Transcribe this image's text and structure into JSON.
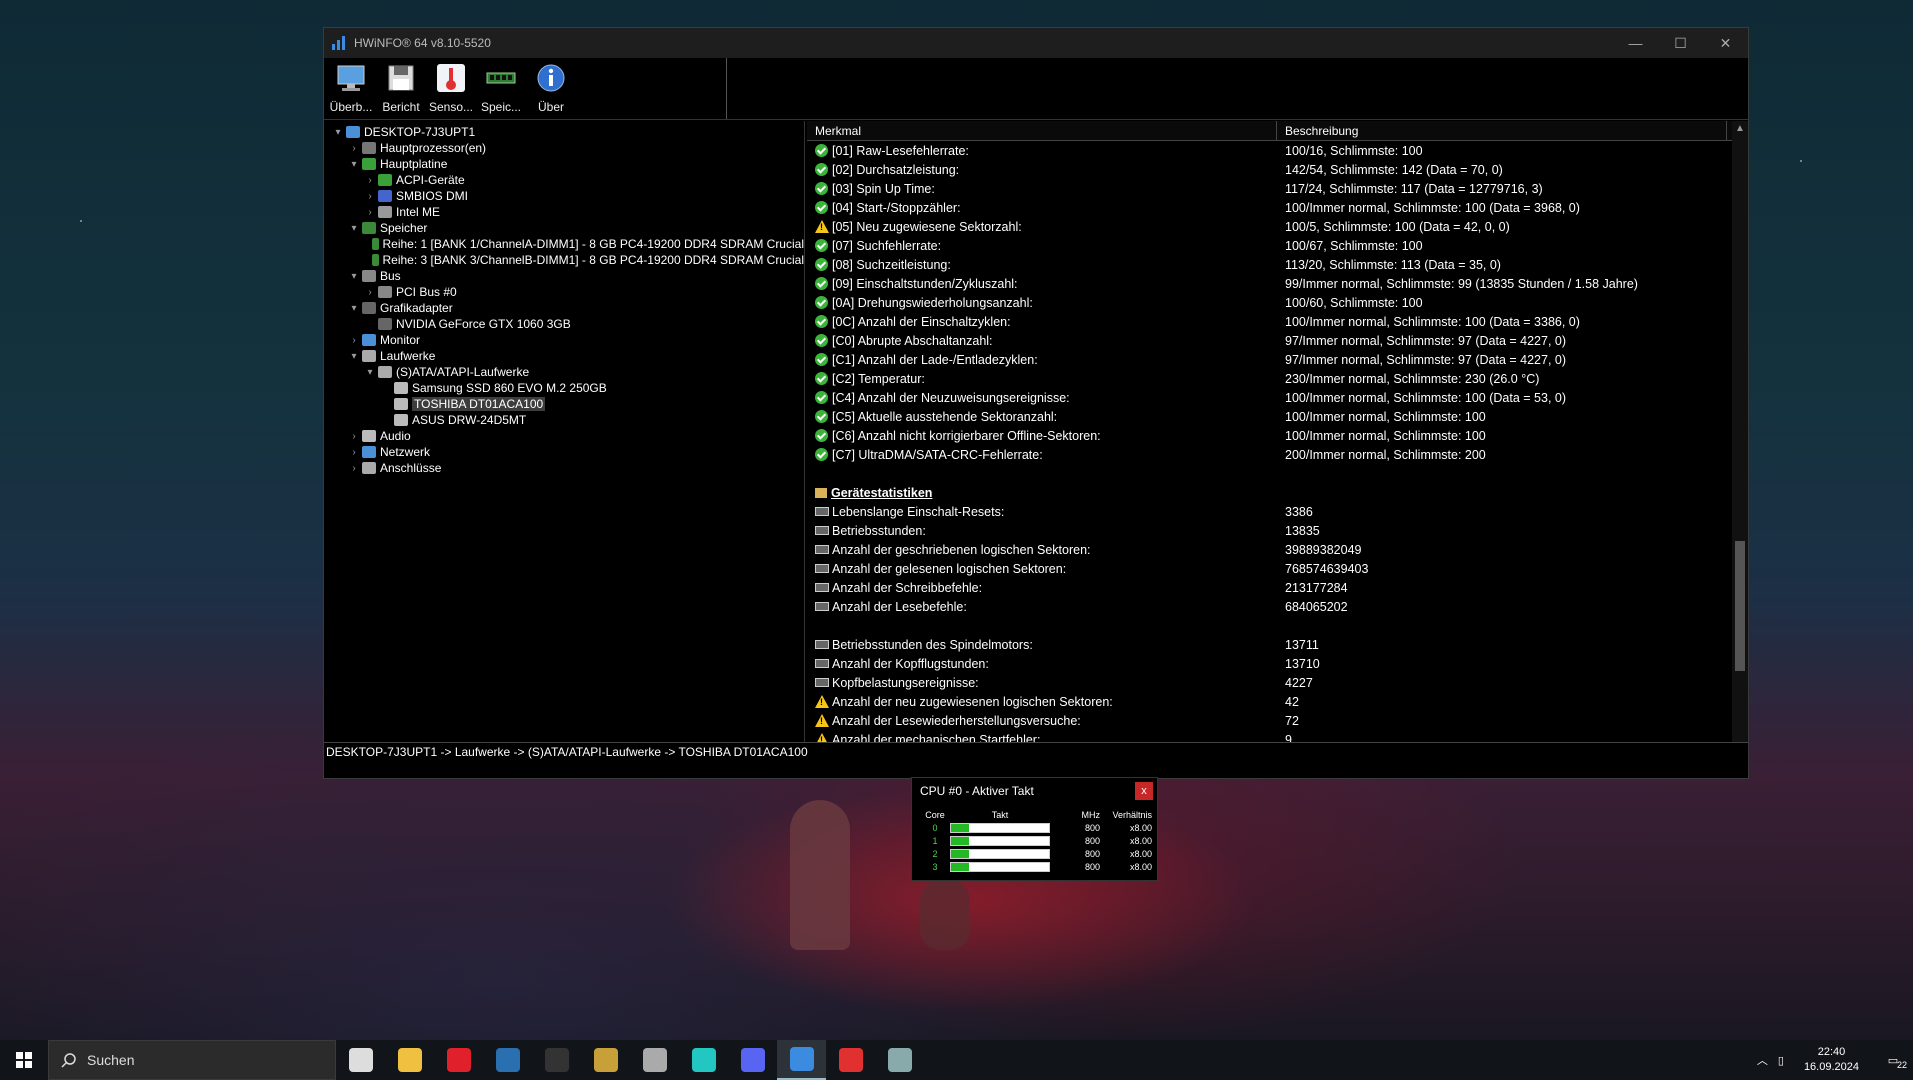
{
  "window": {
    "title": "HWiNFO® 64 v8.10-5520",
    "controls": {
      "minimize": "—",
      "maximize": "☐",
      "close": "✕"
    }
  },
  "toolbar": {
    "items": [
      {
        "label": "Überb...",
        "icon": "monitor-icon"
      },
      {
        "label": "Bericht",
        "icon": "save-icon"
      },
      {
        "label": "Senso...",
        "icon": "thermometer-icon"
      },
      {
        "label": "Speic...",
        "icon": "memory-icon"
      },
      {
        "label": "Über",
        "icon": "info-icon"
      }
    ]
  },
  "tree": {
    "rows": [
      {
        "label": "DESKTOP-7J3UPT1",
        "level": 0,
        "arrow": "▾",
        "color": "#4a90d9"
      },
      {
        "label": "Hauptprozessor(en)",
        "level": 1,
        "arrow": "›",
        "color": "#777"
      },
      {
        "label": "Hauptplatine",
        "level": 1,
        "arrow": "▾",
        "color": "#3aa03a"
      },
      {
        "label": "ACPI-Geräte",
        "level": 2,
        "arrow": "›",
        "color": "#3aa03a"
      },
      {
        "label": "SMBIOS DMI",
        "level": 2,
        "arrow": "›",
        "color": "#4466cc"
      },
      {
        "label": "Intel ME",
        "level": 2,
        "arrow": "›",
        "color": "#999"
      },
      {
        "label": "Speicher",
        "level": 1,
        "arrow": "▾",
        "color": "#3a8a3a"
      },
      {
        "label": "Reihe: 1 [BANK 1/ChannelA-DIMM1] - 8 GB PC4-19200 DDR4 SDRAM Crucial",
        "level": 2,
        "arrow": "",
        "color": "#3a8a3a"
      },
      {
        "label": "Reihe: 3 [BANK 3/ChannelB-DIMM1] - 8 GB PC4-19200 DDR4 SDRAM Crucial",
        "level": 2,
        "arrow": "",
        "color": "#3a8a3a"
      },
      {
        "label": "Bus",
        "level": 1,
        "arrow": "▾",
        "color": "#888"
      },
      {
        "label": "PCI Bus #0",
        "level": 2,
        "arrow": "›",
        "color": "#888"
      },
      {
        "label": "Grafikadapter",
        "level": 1,
        "arrow": "▾",
        "color": "#666"
      },
      {
        "label": "NVIDIA GeForce GTX 1060 3GB",
        "level": 2,
        "arrow": "",
        "color": "#666"
      },
      {
        "label": "Monitor",
        "level": 1,
        "arrow": "›",
        "color": "#4a90d9"
      },
      {
        "label": "Laufwerke",
        "level": 1,
        "arrow": "▾",
        "color": "#aaa"
      },
      {
        "label": "(S)ATA/ATAPI-Laufwerke",
        "level": 2,
        "arrow": "▾",
        "color": "#aaa"
      },
      {
        "label": "Samsung SSD 860 EVO M.2 250GB",
        "level": 3,
        "arrow": "",
        "color": "#bbb"
      },
      {
        "label": "TOSHIBA DT01ACA100",
        "level": 3,
        "arrow": "",
        "color": "#bbb",
        "selected": true
      },
      {
        "label": "ASUS DRW-24D5MT",
        "level": 3,
        "arrow": "",
        "color": "#bbb"
      },
      {
        "label": "Audio",
        "level": 1,
        "arrow": "›",
        "color": "#bbb"
      },
      {
        "label": "Netzwerk",
        "level": 1,
        "arrow": "›",
        "color": "#4a90d9"
      },
      {
        "label": "Anschlüsse",
        "level": 1,
        "arrow": "›",
        "color": "#aaa"
      }
    ]
  },
  "details": {
    "headers": {
      "merkmal": "Merkmal",
      "beschreibung": "Beschreibung"
    },
    "rows": [
      {
        "icon": "ok",
        "name": "[01] Raw-Lesefehlerrate:",
        "value": "100/16, Schlimmste: 100"
      },
      {
        "icon": "ok",
        "name": "[02] Durchsatzleistung:",
        "value": "142/54, Schlimmste: 142 (Data = 70, 0)"
      },
      {
        "icon": "ok",
        "name": "[03] Spin Up Time:",
        "value": "117/24, Schlimmste: 117 (Data = 12779716, 3)"
      },
      {
        "icon": "ok",
        "name": "[04] Start-/Stoppzähler:",
        "value": "100/Immer normal, Schlimmste: 100 (Data = 3968, 0)"
      },
      {
        "icon": "warn",
        "name": "[05] Neu zugewiesene Sektorzahl:",
        "value": "100/5, Schlimmste: 100 (Data = 42, 0, 0)"
      },
      {
        "icon": "ok",
        "name": "[07] Suchfehlerrate:",
        "value": "100/67, Schlimmste: 100"
      },
      {
        "icon": "ok",
        "name": "[08] Suchzeitleistung:",
        "value": "113/20, Schlimmste: 113 (Data = 35, 0)"
      },
      {
        "icon": "ok",
        "name": "[09] Einschaltstunden/Zykluszahl:",
        "value": "99/Immer normal, Schlimmste: 99 (13835 Stunden / 1.58 Jahre)"
      },
      {
        "icon": "ok",
        "name": "[0A] Drehungswiederholungsanzahl:",
        "value": "100/60, Schlimmste: 100"
      },
      {
        "icon": "ok",
        "name": "[0C] Anzahl der Einschaltzyklen:",
        "value": "100/Immer normal, Schlimmste: 100 (Data = 3386, 0)"
      },
      {
        "icon": "ok",
        "name": "[C0] Abrupte Abschaltanzahl:",
        "value": "97/Immer normal, Schlimmste: 97 (Data = 4227, 0)"
      },
      {
        "icon": "ok",
        "name": "[C1] Anzahl der Lade-/Entladezyklen:",
        "value": "97/Immer normal, Schlimmste: 97 (Data = 4227, 0)"
      },
      {
        "icon": "ok",
        "name": "[C2] Temperatur:",
        "value": "230/Immer normal, Schlimmste: 230 (26.0 °C)"
      },
      {
        "icon": "ok",
        "name": "[C4] Anzahl der Neuzuweisungsereignisse:",
        "value": "100/Immer normal, Schlimmste: 100 (Data = 53, 0)"
      },
      {
        "icon": "ok",
        "name": "[C5] Aktuelle ausstehende Sektoranzahl:",
        "value": "100/Immer normal, Schlimmste: 100"
      },
      {
        "icon": "ok",
        "name": "[C6] Anzahl nicht korrigierbarer Offline-Sektoren:",
        "value": "100/Immer normal, Schlimmste: 100"
      },
      {
        "icon": "ok",
        "name": "[C7] UltraDMA/SATA-CRC-Fehlerrate:",
        "value": "200/Immer normal, Schlimmste: 200"
      },
      {
        "icon": "blank",
        "name": "",
        "value": ""
      },
      {
        "icon": "section",
        "name": "Gerätestatistiken",
        "value": ""
      },
      {
        "icon": "disk",
        "name": "Lebenslange Einschalt-Resets:",
        "value": "3386"
      },
      {
        "icon": "disk",
        "name": "Betriebsstunden:",
        "value": "13835"
      },
      {
        "icon": "disk",
        "name": "Anzahl der geschriebenen logischen Sektoren:",
        "value": "39889382049"
      },
      {
        "icon": "disk",
        "name": "Anzahl der gelesenen logischen Sektoren:",
        "value": "768574639403"
      },
      {
        "icon": "disk",
        "name": "Anzahl der Schreibbefehle:",
        "value": "213177284"
      },
      {
        "icon": "disk",
        "name": "Anzahl der Lesebefehle:",
        "value": "684065202"
      },
      {
        "icon": "blank",
        "name": "",
        "value": ""
      },
      {
        "icon": "disk",
        "name": "Betriebsstunden des Spindelmotors:",
        "value": "13711"
      },
      {
        "icon": "disk",
        "name": "Anzahl der Kopfflugstunden:",
        "value": "13710"
      },
      {
        "icon": "disk",
        "name": "Kopfbelastungsereignisse:",
        "value": "4227"
      },
      {
        "icon": "warn",
        "name": "Anzahl der neu zugewiesenen logischen Sektoren:",
        "value": "42"
      },
      {
        "icon": "warn",
        "name": "Anzahl der Lesewiederherstellungsversuche:",
        "value": "72"
      },
      {
        "icon": "warn",
        "name": "Anzahl der mechanischen Startfehler:",
        "value": "9"
      }
    ]
  },
  "statusbar": {
    "path": "DESKTOP-7J3UPT1 -> Laufwerke -> (S)ATA/ATAPI-Laufwerke -> TOSHIBA DT01ACA100"
  },
  "cpu_popup": {
    "title": "CPU #0 - Aktiver Takt",
    "close": "x",
    "headers": {
      "core": "Core",
      "takt": "Takt",
      "mhz": "MHz",
      "ratio": "Verhältnis"
    },
    "rows": [
      {
        "core": "0",
        "mhz": "800",
        "ratio": "x8.00",
        "load": 0.18
      },
      {
        "core": "1",
        "mhz": "800",
        "ratio": "x8.00",
        "load": 0.18
      },
      {
        "core": "2",
        "mhz": "800",
        "ratio": "x8.00",
        "load": 0.18
      },
      {
        "core": "3",
        "mhz": "800",
        "ratio": "x8.00",
        "load": 0.18
      }
    ]
  },
  "taskbar": {
    "search_placeholder": "Suchen",
    "apps": [
      {
        "name": "task-view-icon",
        "color": "#ddd"
      },
      {
        "name": "file-explorer-icon",
        "color": "#f0c040"
      },
      {
        "name": "opera-icon",
        "color": "#e0202a"
      },
      {
        "name": "steam-icon",
        "color": "#2a6fb0"
      },
      {
        "name": "epic-games-icon",
        "color": "#333"
      },
      {
        "name": "league-icon",
        "color": "#c8a03a"
      },
      {
        "name": "spiral-app-icon",
        "color": "#aaa"
      },
      {
        "name": "amazon-music-icon",
        "color": "#21c7c0"
      },
      {
        "name": "discord-icon",
        "color": "#5865f2"
      },
      {
        "name": "hwinfo-icon",
        "color": "#3b8be0"
      },
      {
        "name": "app-red-icon",
        "color": "#e03030"
      },
      {
        "name": "app-window-icon",
        "color": "#8aa"
      }
    ],
    "time": "22:40",
    "date": "16.09.2024",
    "notification_count": "22"
  }
}
